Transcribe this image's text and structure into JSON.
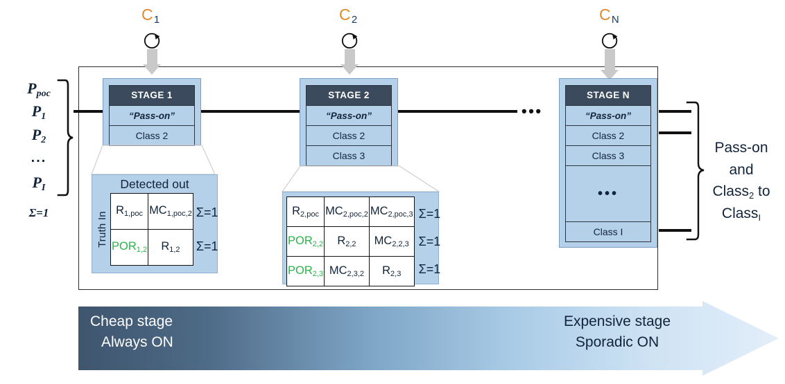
{
  "diagram": {
    "title": "Cascaded multi-stage classifier pass-on diagram",
    "colors": {
      "stage_header": "#3c4a5d",
      "stage_body": "#b5d0e9",
      "por_green": "#2cb34a",
      "control_label_orange": "#e08a2e",
      "flow_line": "#111111",
      "arrow_gradient_start": "#3f556e",
      "arrow_gradient_end": "#dbeaf7"
    }
  },
  "controls": [
    {
      "label": "C",
      "sub": "1",
      "icon": "circular-arrow-icon"
    },
    {
      "label": "C",
      "sub": "2",
      "icon": "circular-arrow-icon"
    },
    {
      "label": "C",
      "sub": "N",
      "icon": "circular-arrow-icon"
    }
  ],
  "inputs": {
    "items": [
      {
        "base": "P",
        "sub": "poc"
      },
      {
        "base": "P",
        "sub": "1"
      },
      {
        "base": "P",
        "sub": "2"
      },
      {
        "base": "...",
        "sub": ""
      },
      {
        "base": "P",
        "sub": "I"
      }
    ],
    "sum_label": "Σ=1"
  },
  "stages": [
    {
      "header": "STAGE 1",
      "rows": [
        "“Pass-on”",
        "Class 2"
      ]
    },
    {
      "header": "STAGE 2",
      "rows": [
        "“Pass-on”",
        "Class 2",
        "Class 3"
      ]
    },
    {
      "header": "STAGE N",
      "rows": [
        "“Pass-on”",
        "Class 2",
        "Class 3",
        "•••",
        "Class I"
      ]
    }
  ],
  "chain_ellipsis": "•••",
  "matrix1": {
    "title": "Detected out",
    "row_axis_label": "Truth In",
    "rows": [
      {
        "cells": [
          {
            "base": "R",
            "sub": "1,poc",
            "green": false
          },
          {
            "base": "MC",
            "sub": "1,poc,2",
            "green": false
          }
        ],
        "sum": "Σ=1"
      },
      {
        "cells": [
          {
            "base": "POR",
            "sub": "1,2",
            "green": true
          },
          {
            "base": "R",
            "sub": "1,2",
            "green": false
          }
        ],
        "sum": "Σ=1"
      }
    ]
  },
  "matrix2": {
    "title": "",
    "rows": [
      {
        "cells": [
          {
            "base": "R",
            "sub": "2,poc",
            "green": false
          },
          {
            "base": "MC",
            "sub": "2,poc,2",
            "green": false
          },
          {
            "base": "MC",
            "sub": "2,poc,3",
            "green": false
          }
        ],
        "sum": "Σ=1"
      },
      {
        "cells": [
          {
            "base": "POR",
            "sub": "2,2",
            "green": true
          },
          {
            "base": "R",
            "sub": "2,2",
            "green": false
          },
          {
            "base": "MC",
            "sub": "2,2,3",
            "green": false
          }
        ],
        "sum": "Σ=1"
      },
      {
        "cells": [
          {
            "base": "POR",
            "sub": "2,3",
            "green": true
          },
          {
            "base": "MC",
            "sub": "2,3,2",
            "green": false
          },
          {
            "base": "R",
            "sub": "2,3",
            "green": false
          }
        ],
        "sum": "Σ=1"
      }
    ]
  },
  "right_annotation": {
    "line1": "Pass-on",
    "line2": "and",
    "line3_pre": "Class",
    "line3_sub": "2",
    "line3_post": " to",
    "line4_pre": "Class",
    "line4_sub": "I"
  },
  "cost_arrow": {
    "left_line1": "Cheap stage",
    "left_line2": "Always ON",
    "right_line1": "Expensive stage",
    "right_line2": "Sporadic ON"
  }
}
